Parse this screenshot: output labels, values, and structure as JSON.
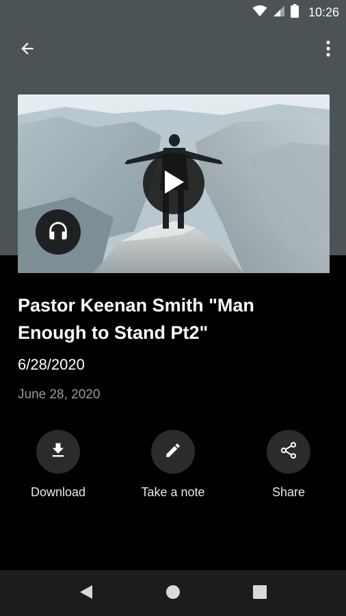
{
  "status_bar": {
    "time": "10:26",
    "icons": [
      "wifi-icon",
      "cellular-signal-icon",
      "battery-icon"
    ]
  },
  "app_bar": {
    "back_icon": "arrow-back-icon",
    "menu_icon": "more-vert-icon"
  },
  "media": {
    "play_icon": "play-icon",
    "audio_icon": "headphones-icon"
  },
  "sermon": {
    "title": "Pastor Keenan Smith \"Man Enough to Stand Pt2\"",
    "date_short": "6/28/2020",
    "date_long": "June 28, 2020"
  },
  "actions": [
    {
      "label": "Download",
      "icon": "download-icon"
    },
    {
      "label": "Take a note",
      "icon": "pencil-icon"
    },
    {
      "label": "Share",
      "icon": "share-icon"
    }
  ],
  "nav_bar": {
    "icons": [
      "nav-back-icon",
      "nav-home-icon",
      "nav-recents-icon"
    ]
  },
  "colors": {
    "header_bg": "#4c5357",
    "body_bg": "#000000",
    "action_circle": "#2b2b2b",
    "secondary_text": "#9a9a9a"
  }
}
